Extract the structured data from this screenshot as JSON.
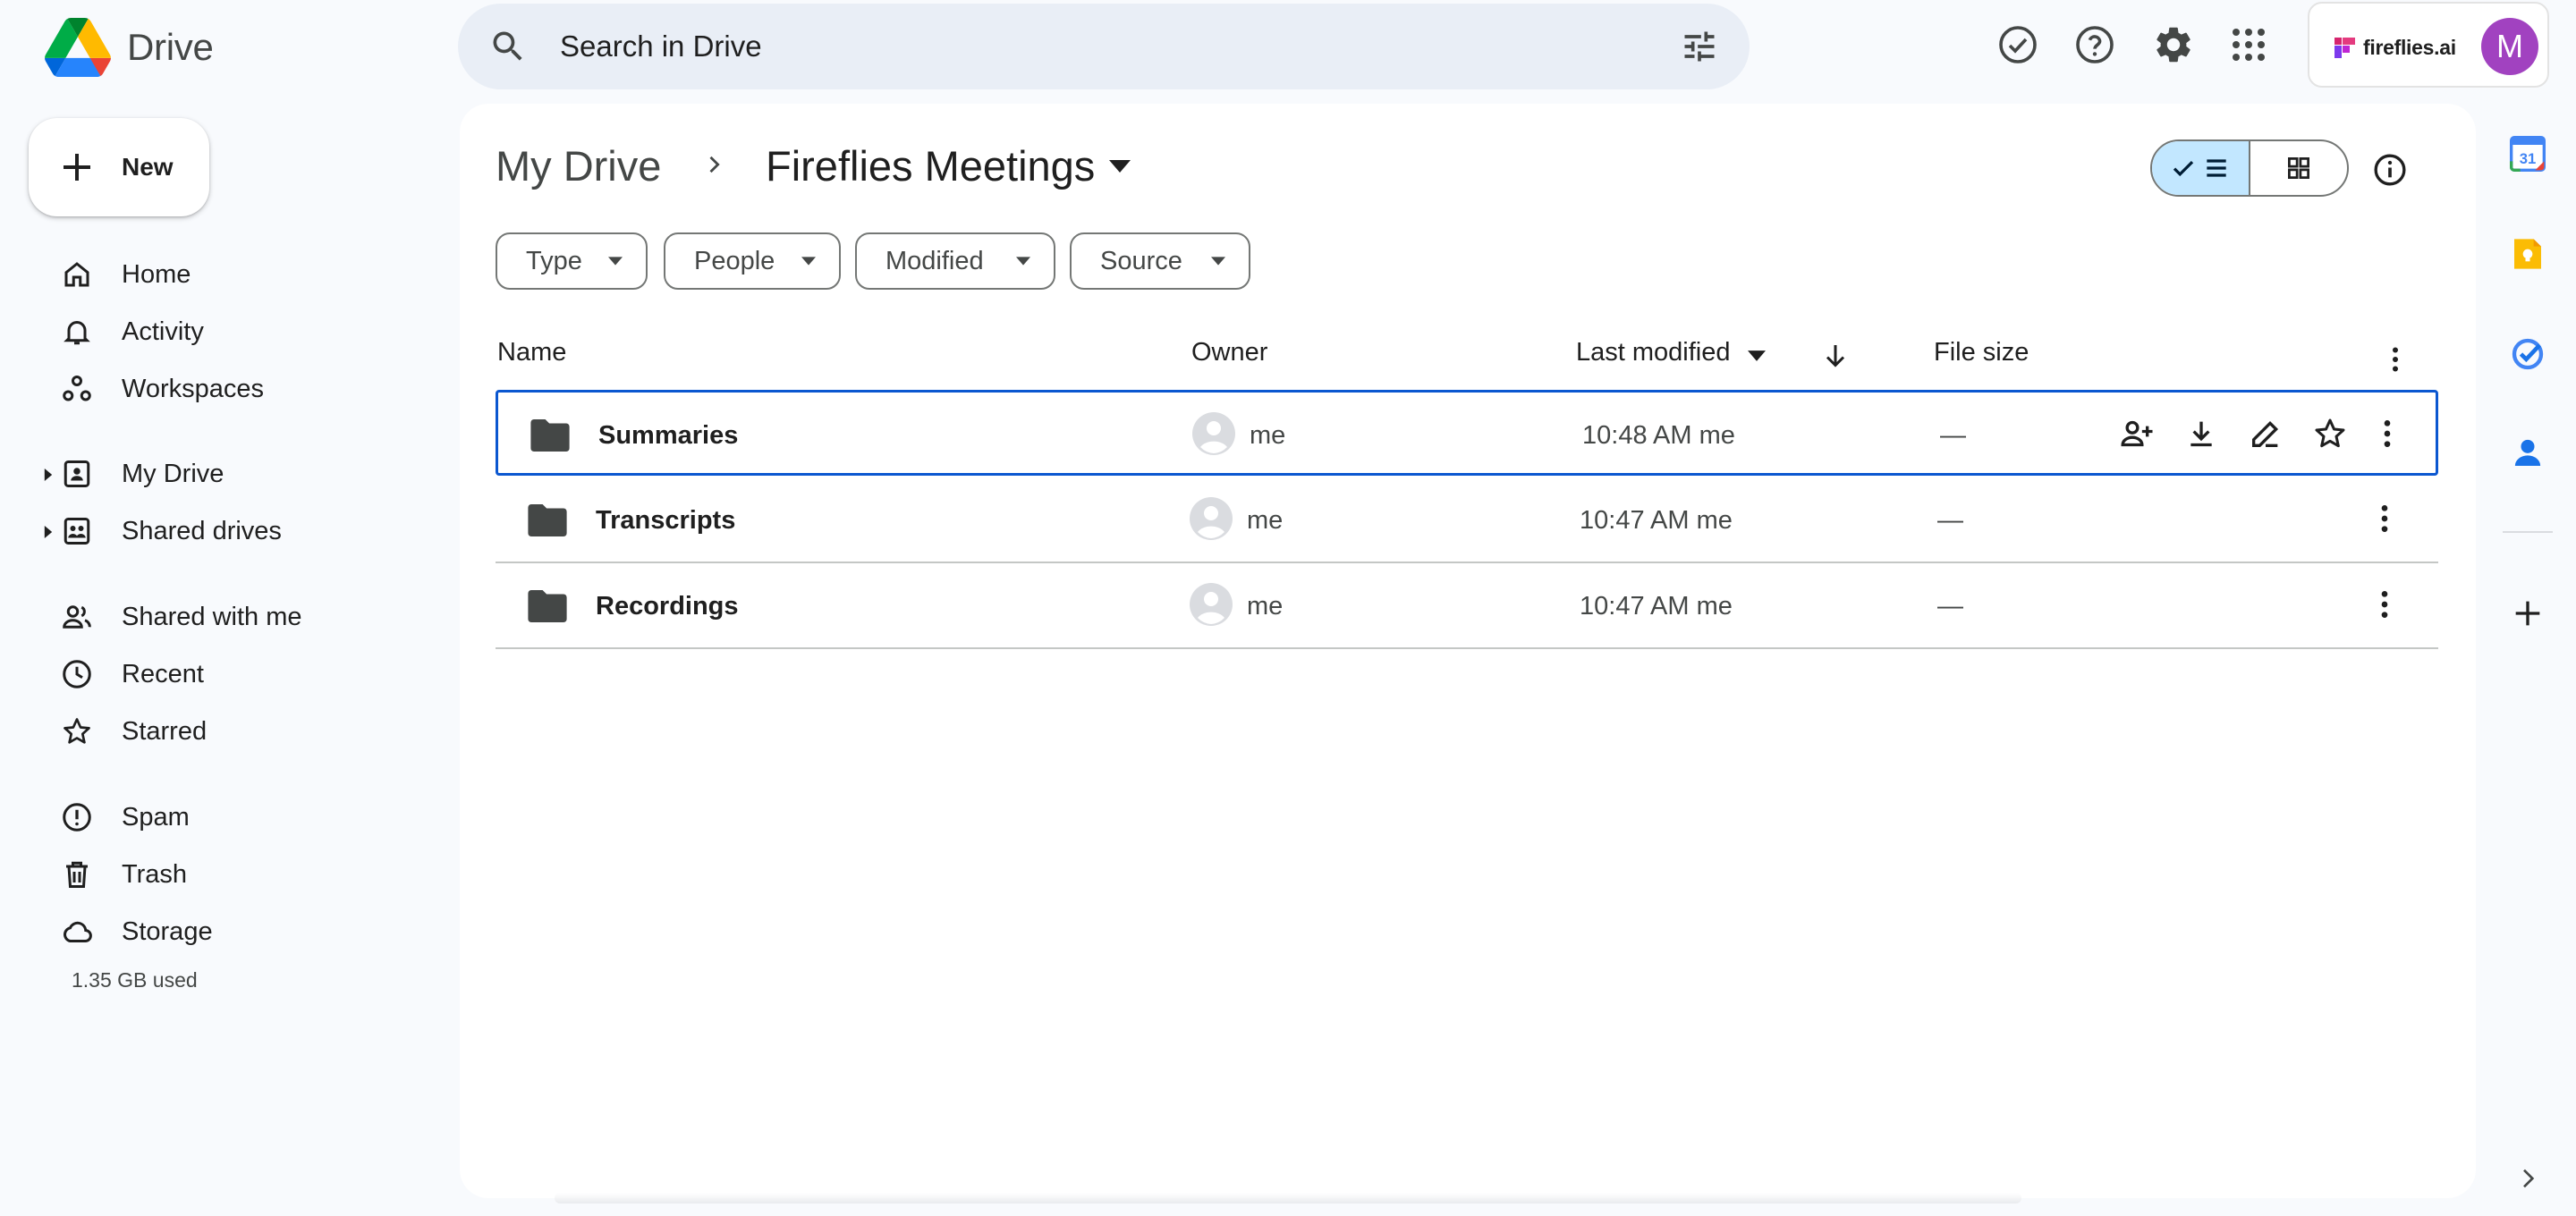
{
  "app": {
    "name": "Drive"
  },
  "search": {
    "placeholder": "Search in Drive"
  },
  "account": {
    "brand": "fireflies.ai",
    "avatar_letter": "M",
    "avatar_color": "#a142c0"
  },
  "sidebar": {
    "new_label": "New",
    "items": [
      {
        "label": "Home",
        "icon": "home-icon"
      },
      {
        "label": "Activity",
        "icon": "bell-icon"
      },
      {
        "label": "Workspaces",
        "icon": "workspaces-icon"
      },
      {
        "label": "My Drive",
        "icon": "my-drive-icon"
      },
      {
        "label": "Shared drives",
        "icon": "shared-drives-icon"
      },
      {
        "label": "Shared with me",
        "icon": "people-icon"
      },
      {
        "label": "Recent",
        "icon": "clock-icon"
      },
      {
        "label": "Starred",
        "icon": "star-icon"
      },
      {
        "label": "Spam",
        "icon": "spam-icon"
      },
      {
        "label": "Trash",
        "icon": "trash-icon"
      },
      {
        "label": "Storage",
        "icon": "cloud-icon"
      }
    ],
    "storage_used": "1.35 GB used"
  },
  "breadcrumb": {
    "root": "My Drive",
    "current": "Fireflies Meetings"
  },
  "filters": [
    "Type",
    "People",
    "Modified",
    "Source"
  ],
  "columns": {
    "name": "Name",
    "owner": "Owner",
    "last_modified": "Last modified",
    "file_size": "File size"
  },
  "files": [
    {
      "name": "Summaries",
      "owner": "me",
      "modified": "10:48 AM me",
      "size": "—",
      "selected": true
    },
    {
      "name": "Transcripts",
      "owner": "me",
      "modified": "10:47 AM me",
      "size": "—",
      "selected": false
    },
    {
      "name": "Recordings",
      "owner": "me",
      "modified": "10:47 AM me",
      "size": "—",
      "selected": false
    }
  ],
  "side_apps": {
    "calendar_day": "31"
  },
  "colors": {
    "accent": "#0b57d0",
    "selected_toggle": "#c2e7ff",
    "search_bg": "#e9eef6"
  }
}
